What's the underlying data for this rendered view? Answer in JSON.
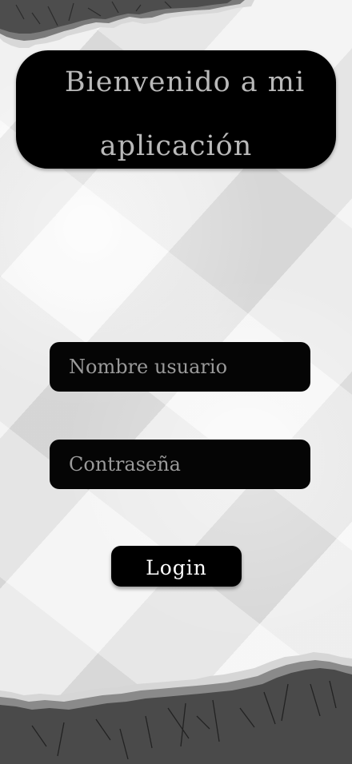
{
  "header": {
    "title_line1": "Bienvenido a mi",
    "title_line2": "aplicación"
  },
  "form": {
    "username_placeholder": "Nombre usuario",
    "password_placeholder": "Contraseña",
    "login_label": "Login"
  },
  "colors": {
    "card_background": "#000000",
    "title_text": "#b9b9b9",
    "placeholder_text": "#9a9a9a",
    "button_text": "#ffffff",
    "paper_background": "#e7e7e7"
  }
}
